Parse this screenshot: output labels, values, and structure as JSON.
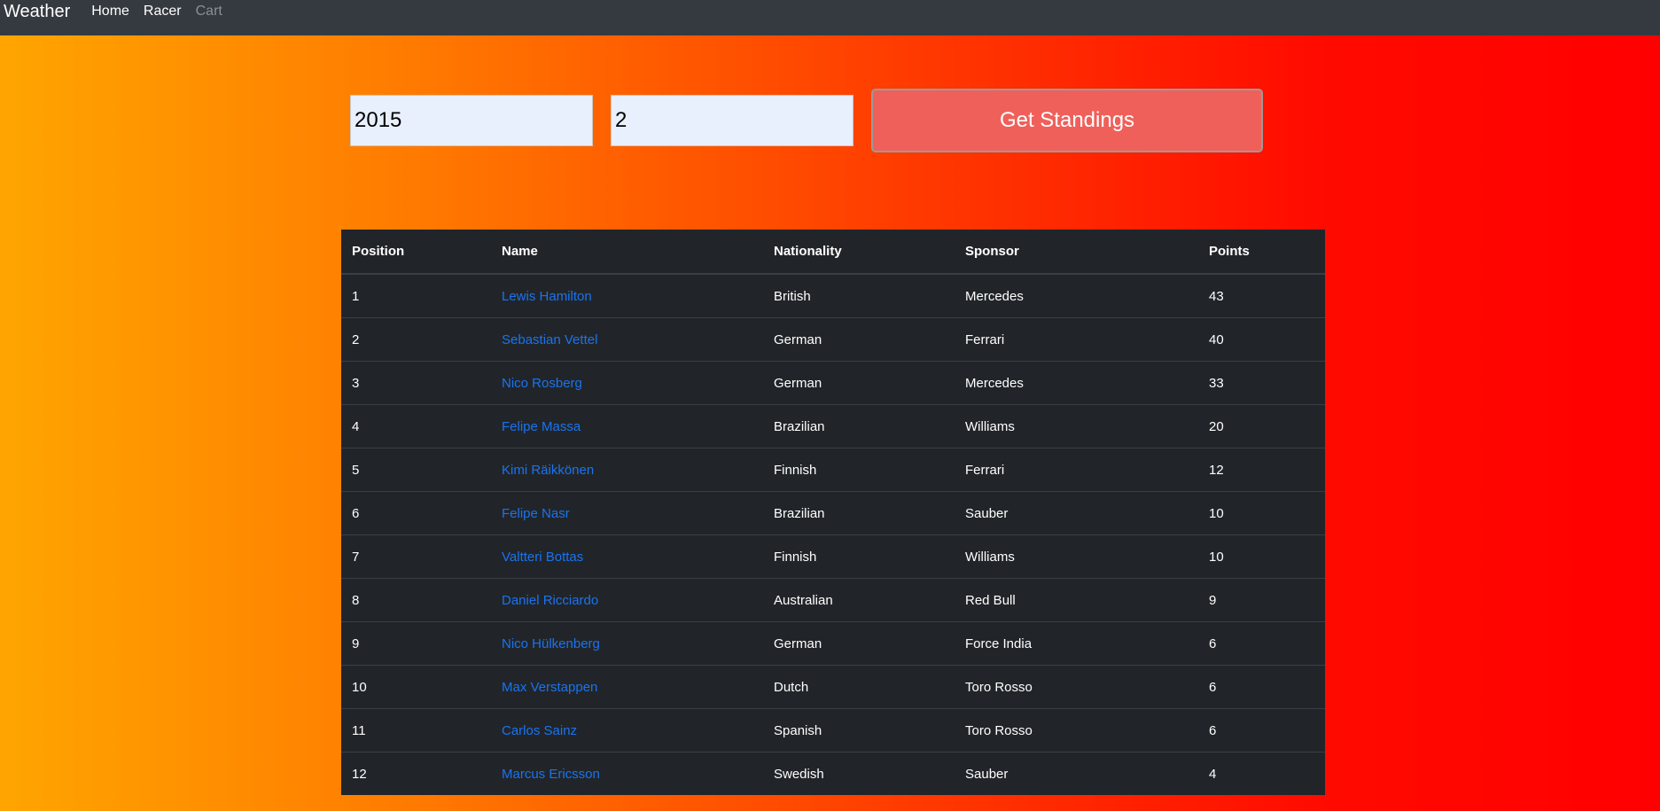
{
  "navbar": {
    "brand": "Weather",
    "links": [
      {
        "label": "Home",
        "disabled": false
      },
      {
        "label": "Racer",
        "disabled": false
      },
      {
        "label": "Cart",
        "disabled": true
      }
    ]
  },
  "form": {
    "year_value": "2015",
    "round_value": "2",
    "submit_label": "Get Standings"
  },
  "table": {
    "headers": [
      "Position",
      "Name",
      "Nationality",
      "Sponsor",
      "Points"
    ],
    "rows": [
      {
        "position": "1",
        "name": "Lewis Hamilton",
        "nationality": "British",
        "sponsor": "Mercedes",
        "points": "43"
      },
      {
        "position": "2",
        "name": "Sebastian Vettel",
        "nationality": "German",
        "sponsor": "Ferrari",
        "points": "40"
      },
      {
        "position": "3",
        "name": "Nico Rosberg",
        "nationality": "German",
        "sponsor": "Mercedes",
        "points": "33"
      },
      {
        "position": "4",
        "name": "Felipe Massa",
        "nationality": "Brazilian",
        "sponsor": "Williams",
        "points": "20"
      },
      {
        "position": "5",
        "name": "Kimi Räikkönen",
        "nationality": "Finnish",
        "sponsor": "Ferrari",
        "points": "12"
      },
      {
        "position": "6",
        "name": "Felipe Nasr",
        "nationality": "Brazilian",
        "sponsor": "Sauber",
        "points": "10"
      },
      {
        "position": "7",
        "name": "Valtteri Bottas",
        "nationality": "Finnish",
        "sponsor": "Williams",
        "points": "10"
      },
      {
        "position": "8",
        "name": "Daniel Ricciardo",
        "nationality": "Australian",
        "sponsor": "Red Bull",
        "points": "9"
      },
      {
        "position": "9",
        "name": "Nico Hülkenberg",
        "nationality": "German",
        "sponsor": "Force India",
        "points": "6"
      },
      {
        "position": "10",
        "name": "Max Verstappen",
        "nationality": "Dutch",
        "sponsor": "Toro Rosso",
        "points": "6"
      },
      {
        "position": "11",
        "name": "Carlos Sainz",
        "nationality": "Spanish",
        "sponsor": "Toro Rosso",
        "points": "6"
      },
      {
        "position": "12",
        "name": "Marcus Ericsson",
        "nationality": "Swedish",
        "sponsor": "Sauber",
        "points": "4"
      }
    ]
  },
  "colors": {
    "navbar_bg": "#343a40",
    "table_bg": "#212529",
    "link": "#1a73f0",
    "button_bg": "#f0605a",
    "gradient_start": "#ffa500",
    "gradient_end": "#ff0000"
  }
}
